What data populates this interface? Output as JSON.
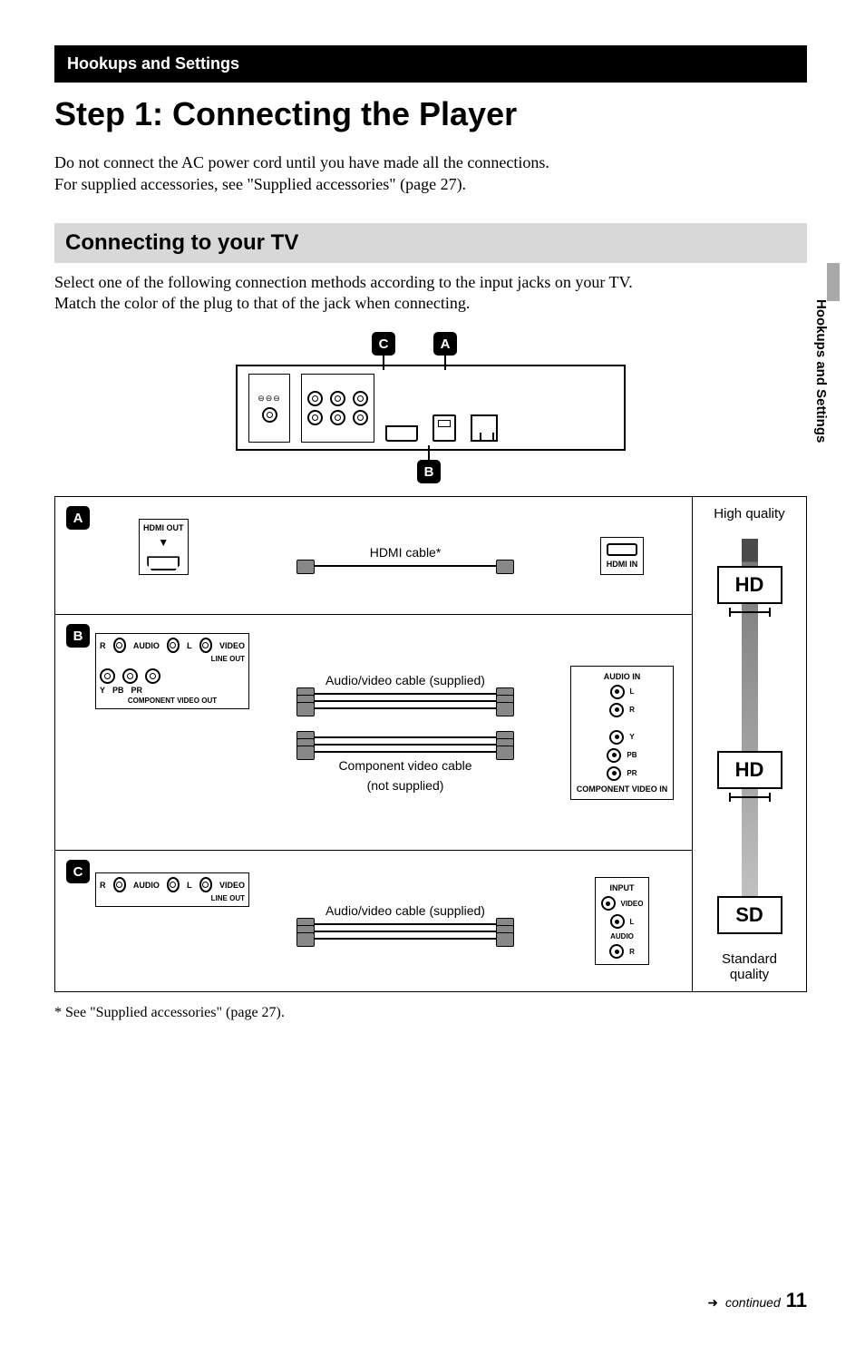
{
  "section_bar": "Hookups and Settings",
  "main_heading": "Step 1: Connecting the Player",
  "intro_line1": "Do not connect the AC power cord until you have made all the connections.",
  "intro_line2": "For supplied accessories, see \"Supplied accessories\" (page 27).",
  "sub_heading": "Connecting to your TV",
  "sub_intro_line1": "Select one of the following connection methods according to the input jacks on your TV.",
  "sub_intro_line2": "Match the color of the plug to that of the jack when connecting.",
  "side_tab": "Hookups and Settings",
  "callouts": {
    "a": "A",
    "b": "B",
    "c": "C"
  },
  "player_labels": {
    "hdmi_out": "HDMI OUT",
    "line_out": "LINE OUT",
    "audio": "AUDIO",
    "video": "VIDEO",
    "component_out": "COMPONENT VIDEO OUT",
    "r": "R",
    "l": "L",
    "y": "Y",
    "pb": "PB",
    "pr": "PR"
  },
  "method_a": {
    "cable": "HDMI cable*",
    "dst_label": "HDMI IN"
  },
  "method_b": {
    "cable_top": "Audio/video cable (supplied)",
    "cable_bottom1": "Component video cable",
    "cable_bottom2": "(not supplied)",
    "dst_audio_in": "AUDIO IN",
    "dst_component_in": "COMPONENT VIDEO IN"
  },
  "method_c": {
    "cable": "Audio/video cable (supplied)",
    "dst_input": "INPUT",
    "dst_video": "VIDEO",
    "dst_audio": "AUDIO"
  },
  "quality": {
    "high": "High quality",
    "standard1": "Standard",
    "standard2": "quality",
    "hd": "HD",
    "sd": "SD"
  },
  "footnote": "* See \"Supplied accessories\" (page 27).",
  "footer": {
    "continued": "continued",
    "page": "11"
  }
}
